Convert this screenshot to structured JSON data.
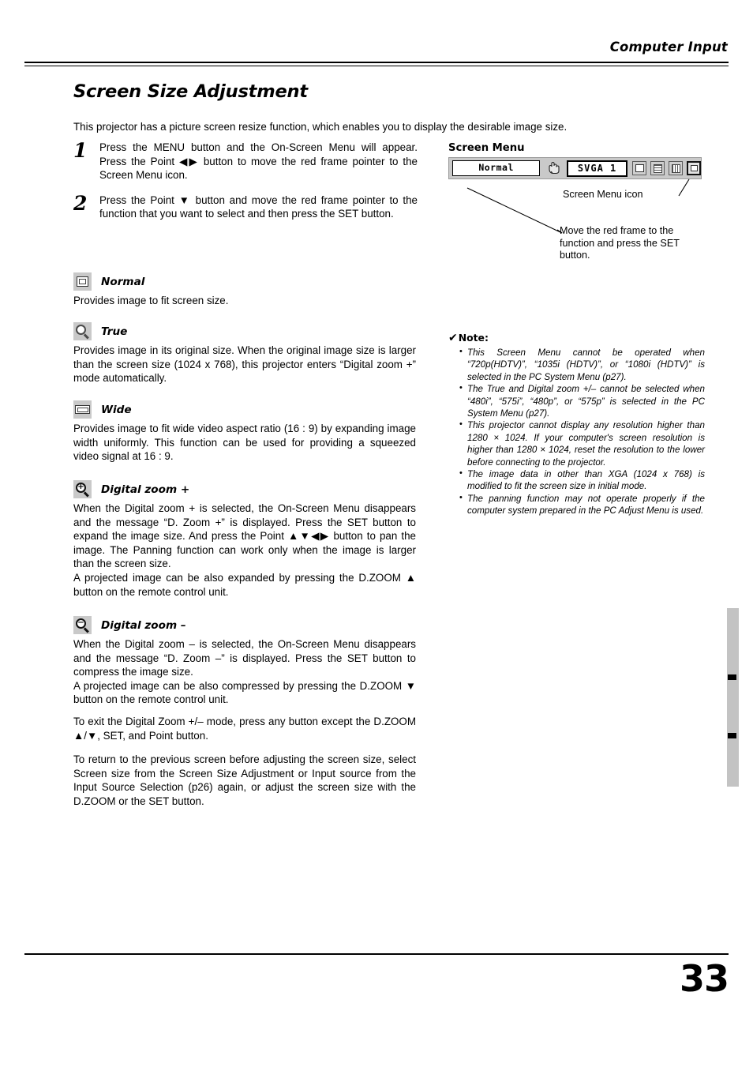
{
  "page": {
    "running_head": "Computer Input",
    "number": "33",
    "title": "Screen Size Adjustment",
    "intro": "This projector has a picture screen resize function, which enables you to display the desirable image size."
  },
  "steps": [
    {
      "num": "1",
      "text": "Press the MENU button and the On-Screen Menu will appear.  Press the Point ◀▶ button to move the red frame pointer to the Screen Menu icon."
    },
    {
      "num": "2",
      "text": "Press the Point ▼ button and move the red frame pointer to the function that you want to select and then press the SET button."
    }
  ],
  "sections": [
    {
      "icon": "normal-screen-icon",
      "label": "Normal",
      "paragraphs": [
        "Provides image to fit screen size."
      ]
    },
    {
      "icon": "magnifier-icon",
      "label": "True",
      "paragraphs": [
        "Provides image in its original size.  When the original image size is larger than the screen size (1024 x 768), this projector enters “Digital zoom +” mode automatically."
      ]
    },
    {
      "icon": "wide-screen-icon",
      "label": "Wide",
      "paragraphs": [
        "Provides image to fit wide video aspect ratio (16 : 9) by expanding image width uniformly.  This function can be used for providing a squeezed video signal at 16 : 9."
      ]
    },
    {
      "icon": "magnifier-plus-icon",
      "label": "Digital zoom +",
      "paragraphs": [
        "When the Digital zoom + is selected, the On-Screen Menu disappears and the message “D. Zoom +” is displayed.  Press the SET button to expand the image size.  And press the Point ▲▼◀▶ button to pan the image.  The Panning function can work only when the image is larger than the screen size.",
        "A projected image can be also expanded by pressing the D.ZOOM ▲ button on the remote control unit."
      ]
    },
    {
      "icon": "magnifier-minus-icon",
      "label": "Digital zoom –",
      "paragraphs": [
        "When the Digital zoom – is selected, the On-Screen Menu disappears and the message “D. Zoom –” is displayed.  Press the SET button to compress the image size.",
        "A projected image can be also compressed by pressing the D.ZOOM ▼ button on the remote control unit."
      ]
    }
  ],
  "closing_paragraphs": [
    "To exit the Digital Zoom +/– mode, press any button except the D.ZOOM ▲/▼, SET, and Point button.",
    "To return to the previous screen before adjusting the screen size, select Screen size from the Screen Size Adjustment or Input source from the Input Source Selection (p26) again, or adjust the screen size with the D.ZOOM or the SET button."
  ],
  "figure": {
    "title": "Screen Menu",
    "osd": {
      "value_label": "Normal",
      "system_label": "SVGA 1",
      "hand_icon": "pointing-hand-icon",
      "menu_tabs": [
        "pc-adjust-icon",
        "image-select-icon",
        "image-adjust-icon",
        "screen-menu-icon"
      ],
      "selected_tab_index": 3,
      "side_items": [
        "normal-screen-icon",
        "true-magnifier-icon",
        "wide-screen-icon",
        "digital-zoom-plus-icon",
        "digital-zoom-minus-icon"
      ],
      "selected_side_index": 0
    },
    "callouts": {
      "menu_icon": "Screen Menu icon",
      "red_frame": "Move the red frame to the function and press the SET button."
    }
  },
  "note": {
    "heading": "Note:",
    "check_glyph": "✔",
    "items": [
      "This Screen Menu cannot be operated when “720p(HDTV)”, “1035i (HDTV)”, or “1080i (HDTV)” is selected in the PC System Menu  (p27).",
      "The True and Digital zoom +/– cannot be selected when “480i”, “575i”, “480p”, or “575p” is selected in the PC System Menu  (p27).",
      "This projector cannot display any resolution higher  than 1280 × 1024.  If your computer's screen resolution is higher than 1280 × 1024, reset the resolution to the  lower before connecting to the projector.",
      "The image data in other than XGA (1024 x 768) is modified to fit the screen size in initial mode.",
      "The panning function may not operate properly if the computer system prepared in the PC Adjust Menu is used."
    ]
  }
}
